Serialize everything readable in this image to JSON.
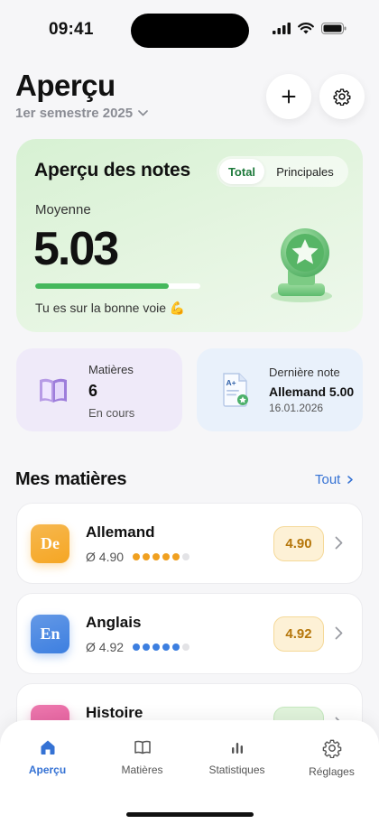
{
  "status_bar": {
    "time": "09:41"
  },
  "header": {
    "title": "Aperçu",
    "semester": "1er semestre 2025"
  },
  "overview": {
    "title": "Aperçu des notes",
    "tabs": [
      "Total",
      "Principales"
    ],
    "active_tab": "Total",
    "average_label": "Moyenne",
    "average_value": "5.03",
    "progress_fraction": 0.81,
    "message": "Tu es sur la bonne voie 💪"
  },
  "stats": {
    "subjects": {
      "label": "Matières",
      "value": "6",
      "sub": "En cours"
    },
    "last_grade": {
      "label": "Dernière note",
      "value": "Allemand 5.00",
      "date": "16.01.2026"
    }
  },
  "subjects_section": {
    "title": "Mes matières",
    "see_all": "Tout"
  },
  "subjects": [
    {
      "abbr": "De",
      "name": "Allemand",
      "average": "Ø 4.90",
      "grade": "4.90",
      "filled": 5,
      "total": 6,
      "color": "#f5a623",
      "dot_color": "#f0a020",
      "pill_bg": "#fdf1d6",
      "pill_border": "#f5d999",
      "pill_color": "#b5760a"
    },
    {
      "abbr": "En",
      "name": "Anglais",
      "average": "Ø 4.92",
      "grade": "4.92",
      "filled": 5,
      "total": 6,
      "color": "#3d7fe0",
      "dot_color": "#3d7fe0",
      "pill_bg": "#fdf1d6",
      "pill_border": "#f5d999",
      "pill_color": "#b5760a"
    },
    {
      "abbr": "",
      "name": "Histoire",
      "average": "",
      "grade": "",
      "filled": 0,
      "total": 6,
      "color": "#e8589b",
      "dot_color": "#e8589b",
      "pill_bg": "#e1f4dc",
      "pill_border": "#c6e9bf",
      "pill_color": "#2d8a43"
    }
  ],
  "tabbar": [
    {
      "label": "Aperçu",
      "icon": "home-icon",
      "active": true
    },
    {
      "label": "Matières",
      "icon": "book-icon",
      "active": false
    },
    {
      "label": "Statistiques",
      "icon": "bar-chart-icon",
      "active": false
    },
    {
      "label": "Réglages",
      "icon": "gear-icon",
      "active": false
    }
  ]
}
